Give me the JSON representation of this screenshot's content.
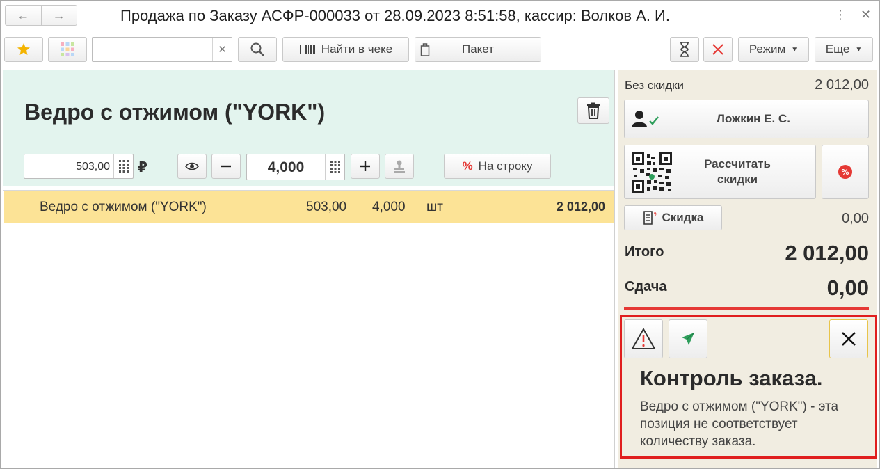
{
  "window": {
    "title": "Продажа по Заказу АСФР-000033 от 28.09.2023 8:51:58, кассир: Волков А. И."
  },
  "toolbar": {
    "search_value": "",
    "find_in_receipt_label": "Найти в чеке",
    "package_label": "Пакет",
    "mode_label": "Режим",
    "more_label": "Еще"
  },
  "item": {
    "title": "Ведро с отжимом (\"YORK\")",
    "price": "503,00",
    "currency": "₽",
    "quantity": "4,000",
    "per_row_label": "На строку"
  },
  "table": {
    "rows": [
      {
        "name": "Ведро с отжимом (\"YORK\")",
        "price": "503,00",
        "qty": "4,000",
        "unit": "шт",
        "sum": "2 012,00"
      }
    ]
  },
  "summary": {
    "no_discount_label": "Без скидки",
    "no_discount_value": "2 012,00",
    "customer_name": "Ложкин Е. С.",
    "calc_discount_label_1": "Рассчитать",
    "calc_discount_label_2": "скидки",
    "discount_label": "Скидка",
    "discount_value": "0,00",
    "total_label": "Итого",
    "total_value": "2 012,00",
    "change_label": "Сдача",
    "change_value": "0,00"
  },
  "notification": {
    "title": "Контроль заказа.",
    "message": "Ведро с отжимом (\"YORK\")  - эта позиция не соответствует количеству заказа."
  },
  "colors": {
    "item_panel_bg": "#e3f4ee",
    "row_highlight": "#fce396",
    "summary_bg": "#f1ede1",
    "alert_red": "#e01e1e",
    "star": "#f4b400",
    "send_green": "#2e9e5b"
  }
}
